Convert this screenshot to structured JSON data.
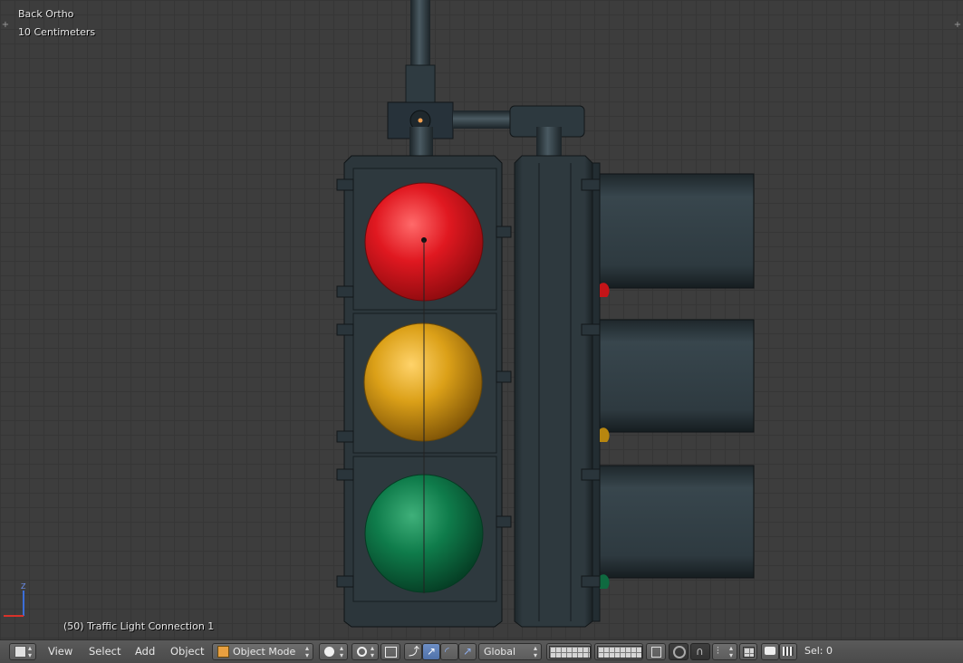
{
  "viewport": {
    "view_name": "Back Ortho",
    "scale_label": "10 Centimeters",
    "object_info": "(50) Traffic Light Connection 1",
    "axis_label": "Z"
  },
  "header": {
    "menu": [
      "View",
      "Select",
      "Add",
      "Object"
    ],
    "mode_label": "Object Mode",
    "orientation_label": "Global",
    "status_label": "Sel: 0"
  },
  "colors": {
    "red_lens": "#d8141c",
    "amber_lens": "#d99a14",
    "green_lens": "#0f7a4a",
    "housing": "#2c363b",
    "origin_dot": "#f0a050"
  }
}
